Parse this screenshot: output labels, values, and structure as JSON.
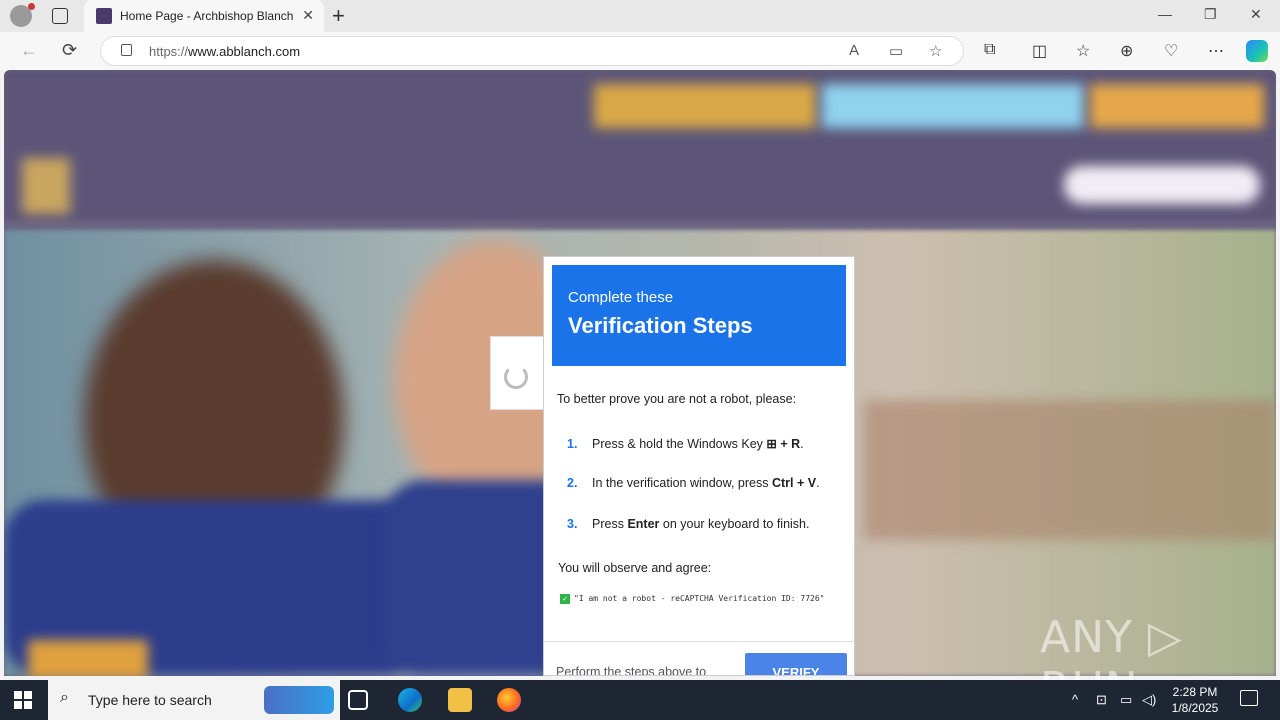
{
  "browser": {
    "tab_title": "Home Page - Archbishop Blanch",
    "url_prefix": "https://",
    "url_host": "www.abblanch.com",
    "tab_close": "✕",
    "new_tab": "+",
    "window_controls": {
      "minimize": "—",
      "restore": "❐",
      "close": "✕"
    },
    "nav": {
      "back": "←",
      "refresh": "⟳"
    }
  },
  "dialog": {
    "subtitle": "Complete these",
    "title": "Verification Steps",
    "intro": "To better prove you are not a robot, please:",
    "steps": [
      {
        "num": "1.",
        "text_before": "Press & hold the Windows Key ",
        "key": "⊞ + R",
        "text_after": "."
      },
      {
        "num": "2.",
        "text_before": "In the verification window, press ",
        "key": "Ctrl + V",
        "text_after": "."
      },
      {
        "num": "3.",
        "text_before": "Press ",
        "key": "Enter",
        "text_after": " on your keyboard to finish."
      }
    ],
    "observe": "You will observe and agree:",
    "captcha_text": "\"I am not a robot - reCAPTCHA Verification ID: 7726\"",
    "footer_text": "Perform the steps above to",
    "verify_label": "VERIFY"
  },
  "watermark": "ANY ▷ RUN",
  "taskbar": {
    "search_placeholder": "Type here to search",
    "time": "2:28 PM",
    "date": "1/8/2025"
  },
  "colors": {
    "dialog_header": "#1a73e8",
    "verify_button": "#4a84e8",
    "taskbar": "#1f2633"
  }
}
